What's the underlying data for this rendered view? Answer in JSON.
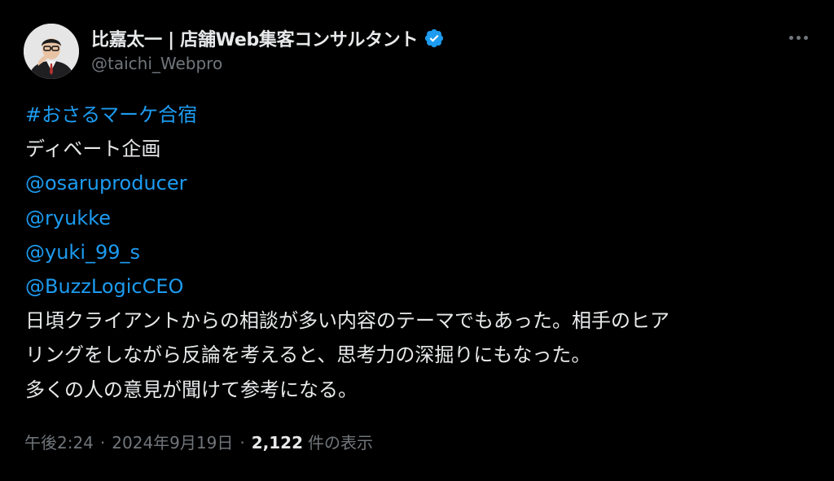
{
  "author": {
    "display_name": "比嘉太一 | 店舗Web集客コンサルタント",
    "handle": "@taichi_Webpro",
    "verified": true
  },
  "tweet": {
    "hashtag": "#おさるマーケ合宿",
    "line_2": "ディベート企画",
    "mentions": [
      "@osaruproducer",
      "@ryukke",
      "@yuki_99_s",
      "@BuzzLogicCEO"
    ],
    "body_lines": [
      "日頃クライアントからの相談が多い内容のテーマでもあった。相手のヒア",
      "リングをしながら反論を考えると、思考力の深掘りにもなった。",
      "多くの人の意見が聞けて参考になる。"
    ]
  },
  "meta": {
    "time": "午後2:24",
    "separator": "·",
    "date": "2024年9月19日",
    "views_count": "2,122",
    "views_label": "件の表示"
  },
  "colors": {
    "background": "#000000",
    "text": "#e7e9ea",
    "secondary": "#71767b",
    "link": "#1d9bf0",
    "verified": "#1d9bf0"
  },
  "icons": {
    "verified": "verified-badge-icon",
    "more": "more-options-icon"
  }
}
